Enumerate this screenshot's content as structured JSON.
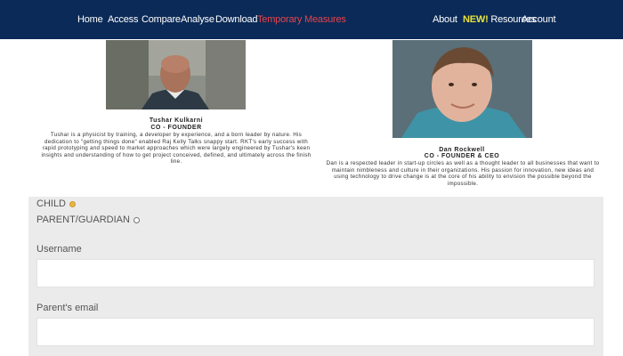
{
  "nav": {
    "home": "Home",
    "access": "Access",
    "compare": "Compare",
    "analyse": "Analyse",
    "download": "Download",
    "temporary_measures": "Temporary Measures",
    "about": "About",
    "resources_badge": "NEW!",
    "resources": "Resources",
    "account": "Account",
    "active_color": "#e8434a",
    "badge_color": "#e8e23a",
    "bar_color": "#0b2a57"
  },
  "profiles": [
    {
      "name": "Tushar Kulkarni",
      "role": "CO - FOUNDER",
      "bio": "Tushar is a physicist by training, a developer by experience, and a born leader by nature. His dedication to \"getting things done\" enabled Raj Kelly Talks snappy start. RKT's early success with rapid prototyping and speed to market approaches which were largely engineered by Tushar's keen insights and understanding of how to get project conceived, defined, and ultimately across the finish line."
    },
    {
      "name": "Dan Rockwell",
      "role": "CO - FOUNDER & CEO",
      "bio": "Dan is a respected leader in start-up circles as well as a thought leader to all businesses that want to maintain nimbleness and culture in their organizations. His passion for innovation, new ideas and using technology to drive change is at the core of his ability to envision the possible beyond the impossible."
    }
  ],
  "form": {
    "child_label": "CHILD",
    "parent_label": "PARENT/GUARDIAN",
    "selected_role": "CHILD",
    "username_label": "Username",
    "username_value": "",
    "parent_email_label": "Parent's email",
    "parent_email_value": ""
  }
}
